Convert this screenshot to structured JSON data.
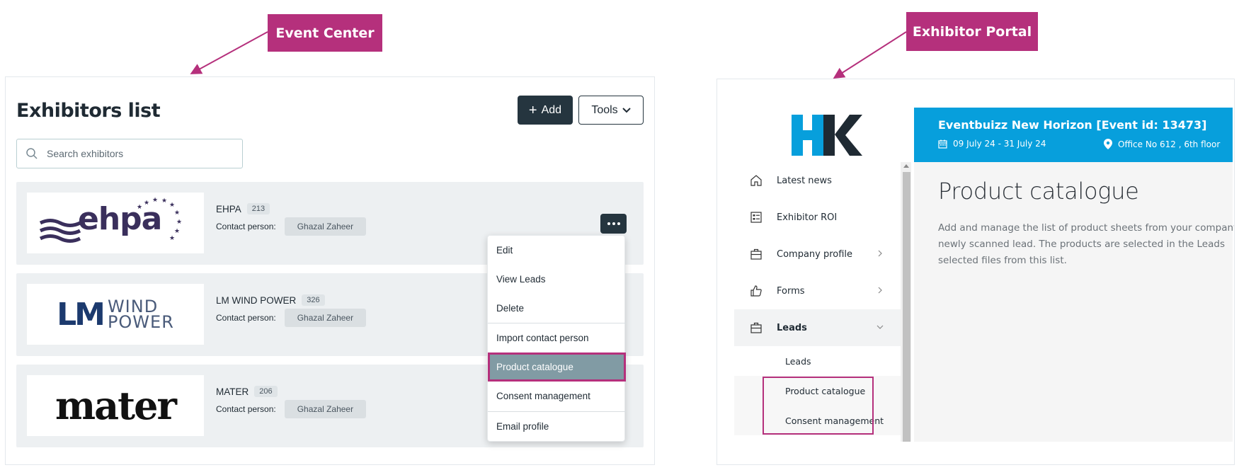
{
  "callouts": {
    "left": "Event Center",
    "right": "Exhibitor Portal"
  },
  "event_center": {
    "title": "Exhibitors list",
    "add_label": "Add",
    "tools_label": "Tools",
    "search_placeholder": "Search exhibitors",
    "contact_label": "Contact person:",
    "exhibitors": [
      {
        "name": "EHPA",
        "count": "213",
        "contact": "Ghazal Zaheer",
        "logo": "ehpa"
      },
      {
        "name": "LM WIND POWER",
        "count": "326",
        "contact": "Ghazal Zaheer",
        "logo_main": "LM",
        "logo_line1": "WIND",
        "logo_line2": "POWER"
      },
      {
        "name": "MATER",
        "count": "206",
        "contact": "Ghazal Zaheer",
        "logo": "mater"
      }
    ],
    "menu": [
      "Edit",
      "View Leads",
      "Delete",
      "Import contact person",
      "Product catalogue",
      "Consent management",
      "Email profile"
    ]
  },
  "exhibitor_portal": {
    "event_title": "Eventbuizz New Horizon [Event id: 13473]",
    "event_dates": "09 July 24 - 31 July 24",
    "event_location": "Office No 612 , 6th floor",
    "sidebar": [
      {
        "label": "Latest news"
      },
      {
        "label": "Exhibitor ROI"
      },
      {
        "label": "Company profile"
      },
      {
        "label": "Forms"
      },
      {
        "label": "Leads"
      }
    ],
    "sub_items": [
      "Leads",
      "Product catalogue",
      "Consent management"
    ],
    "page_title": "Product catalogue",
    "description_lines": [
      "Add and manage the list of product sheets from your company",
      "newly scanned lead. The products are selected in the Leads",
      "selected files from this list."
    ]
  },
  "colors": {
    "accent": "#b5307c",
    "dark_button": "#25353f",
    "header_blue": "#079fdc",
    "menu_active": "#819ba4"
  }
}
